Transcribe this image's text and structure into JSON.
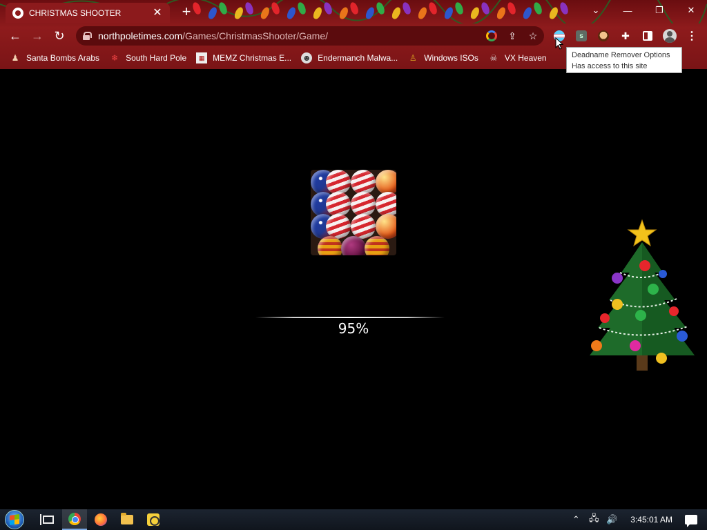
{
  "browser": {
    "tab_title": "CHRISTMAS SHOOTER",
    "tab_close": "✕",
    "new_tab": "+",
    "url_domain": "northpoletimes.com",
    "url_path": "/Games/ChristmasShooter/Game/",
    "window": {
      "minimize": "—",
      "maximize": "❐",
      "close": "✕",
      "dropdown": "⌄"
    },
    "nav": {
      "back": "←",
      "forward": "→",
      "reload": "↻"
    },
    "bookmarks": [
      {
        "label": "Santa Bombs Arabs",
        "icon": "santa-icon"
      },
      {
        "label": "South Hard Pole",
        "icon": "snowflake-icon"
      },
      {
        "label": "MEMZ Christmas E...",
        "icon": "memz-icon"
      },
      {
        "label": "Endermanch Malwa...",
        "icon": "raccoon-icon"
      },
      {
        "label": "Windows ISOs",
        "icon": "figure-icon"
      },
      {
        "label": "VX Heaven",
        "icon": "vx-icon"
      }
    ],
    "tooltip": {
      "line1": "Deadname Remover Options",
      "line2": "Has access to this site"
    },
    "theme_color": "#8e1b1c"
  },
  "game": {
    "progress_percent": 95,
    "progress_label": "95%"
  },
  "taskbar": {
    "clock": "3:45:01 AM",
    "tray_up": "⌃",
    "tray_network": "🖧",
    "tray_volume": "🔊",
    "apps": [
      "task-view",
      "chrome",
      "firefox",
      "file-explorer",
      "snipping-tool"
    ]
  }
}
